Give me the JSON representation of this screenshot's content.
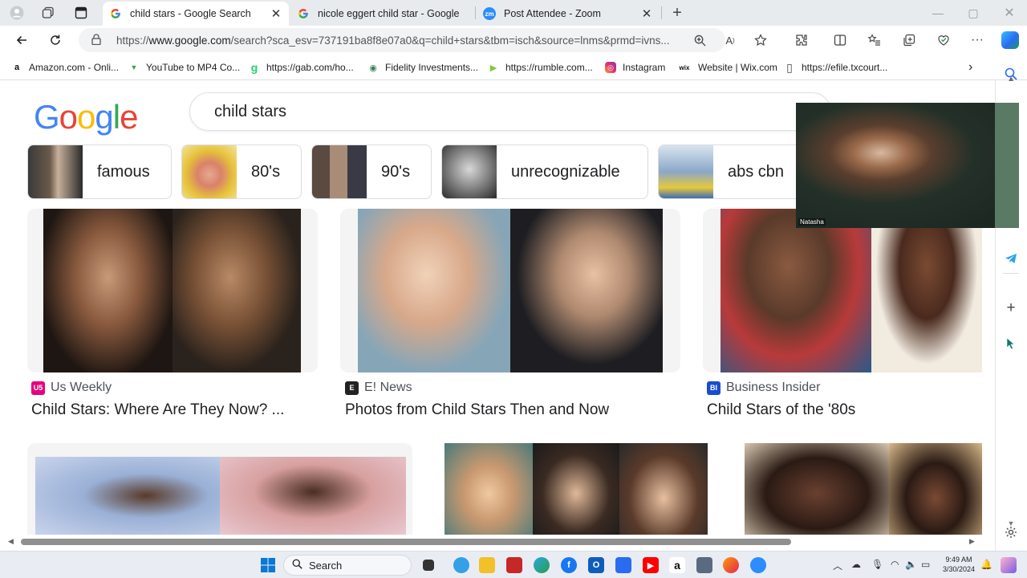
{
  "tabs": [
    {
      "title": "child stars - Google Search",
      "favicon": "google-g-icon"
    },
    {
      "title": "nicole eggert child star - Google",
      "favicon": "google-g-icon"
    },
    {
      "title": "Post Attendee - Zoom",
      "favicon": "zoom-icon",
      "fav_text": "zm"
    }
  ],
  "address": {
    "url_prefix": "https://",
    "url_host": "www.google.com",
    "url_rest": "/search?sca_esv=737191ba8f8e07a0&q=child+stars&tbm=isch&source=lnms&prmd=ivns..."
  },
  "bookmarks": [
    {
      "label": "Amazon.com - Onli...",
      "icon_text": "a"
    },
    {
      "label": "YouTube to MP4 Co...",
      "icon_text": "▼"
    },
    {
      "label": "https://gab.com/ho...",
      "icon_text": "g"
    },
    {
      "label": "Fidelity Investments...",
      "icon_text": "◉"
    },
    {
      "label": "https://rumble.com...",
      "icon_text": "▶"
    },
    {
      "label": "Instagram",
      "icon_text": "◎"
    },
    {
      "label": "Website | Wix.com",
      "icon_text": "wix"
    },
    {
      "label": "https://efile.txcourt...",
      "icon_text": "▯"
    }
  ],
  "google": {
    "logo_letters": [
      "G",
      "o",
      "o",
      "g",
      "l",
      "e"
    ],
    "query": "child stars"
  },
  "chips": [
    {
      "label": "famous"
    },
    {
      "label": "80's"
    },
    {
      "label": "90's"
    },
    {
      "label": "unrecognizable"
    },
    {
      "label": "abs cbn"
    }
  ],
  "results": [
    {
      "source": "Us Weekly",
      "source_icon_text": "U5",
      "title": "Child Stars: Where Are They Now? ..."
    },
    {
      "source": "E! News",
      "source_icon_text": "E",
      "title": "Photos from Child Stars Then and Now"
    },
    {
      "source": "Business Insider",
      "source_icon_text": "BI",
      "title": "Child Stars of the '80s"
    }
  ],
  "zoom": {
    "participant": "Natasha"
  },
  "taskbar": {
    "search_label": "Search",
    "time": "9:49 AM",
    "date": "3/30/2024"
  },
  "colors": {
    "google_blue": "#4285f4",
    "google_red": "#ea4335",
    "google_yellow": "#fbbc05",
    "google_green": "#34a853"
  }
}
